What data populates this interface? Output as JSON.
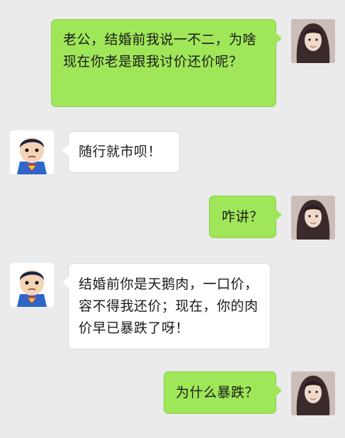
{
  "chat": {
    "messages": [
      {
        "side": "right",
        "sender": "wife",
        "text": "老公，结婚前我说一不二，为啥现在你老是跟我讨价还价呢？"
      },
      {
        "side": "left",
        "sender": "husband",
        "text": "随行就市呗！"
      },
      {
        "side": "right",
        "sender": "wife",
        "text": "咋讲？"
      },
      {
        "side": "left",
        "sender": "husband",
        "text": "结婚前你是天鹅肉，一口价，容不得我还价；现在，你的肉价早已暴跌了呀！"
      },
      {
        "side": "right",
        "sender": "wife",
        "text": "为什么暴跌？"
      }
    ]
  },
  "avatars": {
    "wife": "woman-photo-avatar",
    "husband": "superman-cartoon-avatar"
  },
  "colors": {
    "background": "#ebebeb",
    "outgoing_bubble": "#9fe659",
    "incoming_bubble": "#ffffff"
  }
}
